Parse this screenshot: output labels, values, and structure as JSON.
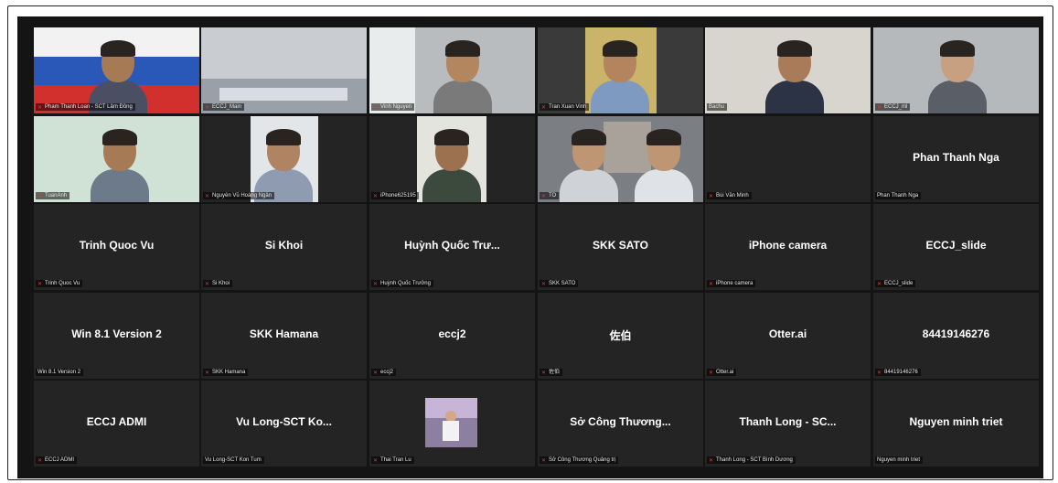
{
  "colors": {
    "grid_bg": "#141414",
    "tile_bg": "#242424",
    "active_outline": "#b5d24a",
    "muted_icon": "#e03b2f"
  },
  "participants": [
    {
      "label": "Pham Thanh Loan - SCT Lâm Đồng",
      "big": "",
      "muted": true,
      "video": true
    },
    {
      "label": "ECCJ_Main",
      "big": "",
      "muted": true,
      "video": true,
      "active": true
    },
    {
      "label": "Vinh Nguyen",
      "big": "",
      "muted": true,
      "video": true
    },
    {
      "label": "Tran Xuan Vinh",
      "big": "",
      "muted": true,
      "video": true
    },
    {
      "label": "Bachu",
      "big": "",
      "muted": false,
      "video": true
    },
    {
      "label": "ECCJ_ml",
      "big": "",
      "muted": true,
      "video": true
    },
    {
      "label": "TuanAnh",
      "big": "",
      "muted": true,
      "video": true
    },
    {
      "label": "Nguyễn Vũ Hoàng Ngân",
      "big": "",
      "muted": true,
      "video": true
    },
    {
      "label": "iPhone625195",
      "big": "",
      "muted": true,
      "video": true
    },
    {
      "label": "TO",
      "big": "",
      "muted": true,
      "video": true
    },
    {
      "label": "Bùi Văn Minh",
      "big": "",
      "muted": true,
      "video": false
    },
    {
      "label": "Phan Thanh Nga",
      "big": "Phan Thanh Nga",
      "muted": false,
      "video": false
    },
    {
      "label": "Trinh Quoc Vu",
      "big": "Trinh Quoc Vu",
      "muted": true,
      "video": false
    },
    {
      "label": "Si Khoi",
      "big": "Si Khoi",
      "muted": true,
      "video": false
    },
    {
      "label": "Huỳnh Quốc Trưởng",
      "big": "Huỳnh Quốc Trư...",
      "muted": true,
      "video": false
    },
    {
      "label": "SKK SATO",
      "big": "SKK SATO",
      "muted": true,
      "video": false
    },
    {
      "label": "iPhone camera",
      "big": "iPhone camera",
      "muted": true,
      "video": false
    },
    {
      "label": "ECCJ_slide",
      "big": "ECCJ_slide",
      "muted": true,
      "video": false
    },
    {
      "label": "Win 8.1 Version 2",
      "big": "Win 8.1 Version 2",
      "muted": false,
      "video": false
    },
    {
      "label": "SKK Hamana",
      "big": "SKK Hamana",
      "muted": true,
      "video": false
    },
    {
      "label": "eccj2",
      "big": "eccj2",
      "muted": true,
      "video": false
    },
    {
      "label": "佐伯",
      "big": "佐伯",
      "muted": true,
      "video": false
    },
    {
      "label": "Otter.ai",
      "big": "Otter.ai",
      "muted": true,
      "video": false
    },
    {
      "label": "84419146276",
      "big": "84419146276",
      "muted": true,
      "video": false
    },
    {
      "label": "ECCJ ADMI",
      "big": "ECCJ  ADMI",
      "muted": true,
      "video": false
    },
    {
      "label": "Vu Long-SCT Kon Tum",
      "big": "Vu Long-SCT Ko...",
      "muted": false,
      "video": false
    },
    {
      "label": "Thai Tran Lu",
      "big": "",
      "muted": true,
      "video": false,
      "thumb": true
    },
    {
      "label": "Sở Công Thương Quảng trị",
      "big": "Sở Công Thương...",
      "muted": true,
      "video": false
    },
    {
      "label": "Thanh Long - SCT Bình Dương",
      "big": "Thanh Long - SC...",
      "muted": true,
      "video": false
    },
    {
      "label": "Nguyen minh triet",
      "big": "Nguyen minh triet",
      "muted": false,
      "video": false
    }
  ]
}
